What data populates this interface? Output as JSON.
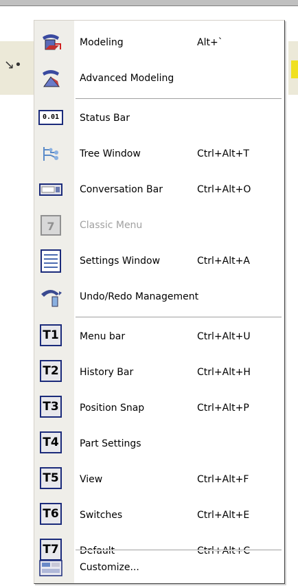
{
  "menu": {
    "items": [
      {
        "label": "Modeling",
        "shortcut": "Alt+`",
        "icon": "modeling-icon",
        "enabled": true
      },
      {
        "label": "Advanced Modeling",
        "shortcut": "",
        "icon": "advanced-modeling-icon",
        "enabled": true
      },
      {
        "label": "Status Bar",
        "shortcut": "",
        "icon": "status-bar-icon",
        "enabled": true
      },
      {
        "label": "Tree Window",
        "shortcut": "Ctrl+Alt+T",
        "icon": "tree-window-icon",
        "enabled": true
      },
      {
        "label": "Conversation Bar",
        "shortcut": "Ctrl+Alt+O",
        "icon": "conversation-bar-icon",
        "enabled": true
      },
      {
        "label": "Classic Menu",
        "shortcut": "",
        "icon": "classic-menu-icon",
        "enabled": false
      },
      {
        "label": "Settings Window",
        "shortcut": "Ctrl+Alt+A",
        "icon": "settings-window-icon",
        "enabled": true
      },
      {
        "label": "Undo/Redo Management",
        "shortcut": "",
        "icon": "undo-redo-icon",
        "enabled": true
      },
      {
        "label": "Menu bar",
        "shortcut": "Ctrl+Alt+U",
        "icon_text": "T1",
        "enabled": true
      },
      {
        "label": "History Bar",
        "shortcut": "Ctrl+Alt+H",
        "icon_text": "T2",
        "enabled": true
      },
      {
        "label": "Position Snap",
        "shortcut": "Ctrl+Alt+P",
        "icon_text": "T3",
        "enabled": true
      },
      {
        "label": "Part Settings",
        "shortcut": "",
        "icon_text": "T4",
        "enabled": true
      },
      {
        "label": "View",
        "shortcut": "Ctrl+Alt+F",
        "icon_text": "T5",
        "enabled": true
      },
      {
        "label": "Switches",
        "shortcut": "Ctrl+Alt+E",
        "icon_text": "T6",
        "enabled": true
      },
      {
        "label": "Default",
        "shortcut": "Ctrl+Alt+C",
        "icon_text": "T7",
        "enabled": true
      },
      {
        "label": "Customize...",
        "shortcut": "",
        "icon": "customize-icon",
        "enabled": true
      }
    ],
    "status_icon_text": "0.01"
  }
}
